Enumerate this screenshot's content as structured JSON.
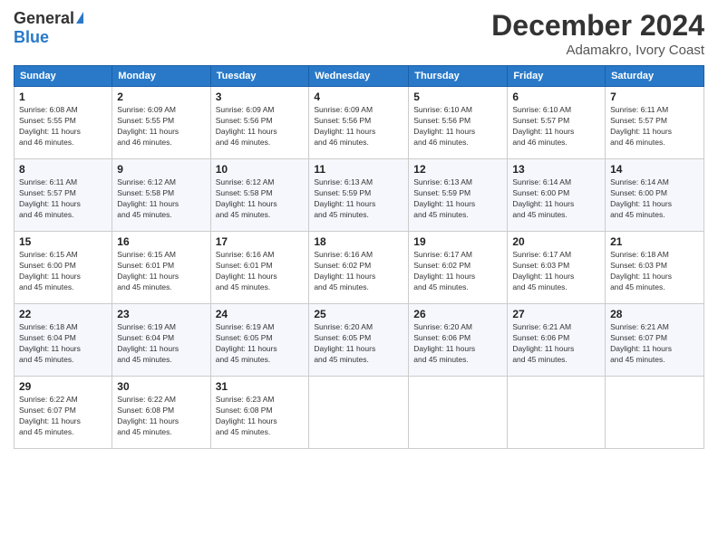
{
  "logo": {
    "general": "General",
    "blue": "Blue"
  },
  "header": {
    "month": "December 2024",
    "location": "Adamakro, Ivory Coast"
  },
  "weekdays": [
    "Sunday",
    "Monday",
    "Tuesday",
    "Wednesday",
    "Thursday",
    "Friday",
    "Saturday"
  ],
  "weeks": [
    [
      {
        "day": "1",
        "sunrise": "6:08 AM",
        "sunset": "5:55 PM",
        "daylight": "11 hours and 46 minutes."
      },
      {
        "day": "2",
        "sunrise": "6:09 AM",
        "sunset": "5:55 PM",
        "daylight": "11 hours and 46 minutes."
      },
      {
        "day": "3",
        "sunrise": "6:09 AM",
        "sunset": "5:56 PM",
        "daylight": "11 hours and 46 minutes."
      },
      {
        "day": "4",
        "sunrise": "6:09 AM",
        "sunset": "5:56 PM",
        "daylight": "11 hours and 46 minutes."
      },
      {
        "day": "5",
        "sunrise": "6:10 AM",
        "sunset": "5:56 PM",
        "daylight": "11 hours and 46 minutes."
      },
      {
        "day": "6",
        "sunrise": "6:10 AM",
        "sunset": "5:57 PM",
        "daylight": "11 hours and 46 minutes."
      },
      {
        "day": "7",
        "sunrise": "6:11 AM",
        "sunset": "5:57 PM",
        "daylight": "11 hours and 46 minutes."
      }
    ],
    [
      {
        "day": "8",
        "sunrise": "6:11 AM",
        "sunset": "5:57 PM",
        "daylight": "11 hours and 46 minutes."
      },
      {
        "day": "9",
        "sunrise": "6:12 AM",
        "sunset": "5:58 PM",
        "daylight": "11 hours and 45 minutes."
      },
      {
        "day": "10",
        "sunrise": "6:12 AM",
        "sunset": "5:58 PM",
        "daylight": "11 hours and 45 minutes."
      },
      {
        "day": "11",
        "sunrise": "6:13 AM",
        "sunset": "5:59 PM",
        "daylight": "11 hours and 45 minutes."
      },
      {
        "day": "12",
        "sunrise": "6:13 AM",
        "sunset": "5:59 PM",
        "daylight": "11 hours and 45 minutes."
      },
      {
        "day": "13",
        "sunrise": "6:14 AM",
        "sunset": "6:00 PM",
        "daylight": "11 hours and 45 minutes."
      },
      {
        "day": "14",
        "sunrise": "6:14 AM",
        "sunset": "6:00 PM",
        "daylight": "11 hours and 45 minutes."
      }
    ],
    [
      {
        "day": "15",
        "sunrise": "6:15 AM",
        "sunset": "6:00 PM",
        "daylight": "11 hours and 45 minutes."
      },
      {
        "day": "16",
        "sunrise": "6:15 AM",
        "sunset": "6:01 PM",
        "daylight": "11 hours and 45 minutes."
      },
      {
        "day": "17",
        "sunrise": "6:16 AM",
        "sunset": "6:01 PM",
        "daylight": "11 hours and 45 minutes."
      },
      {
        "day": "18",
        "sunrise": "6:16 AM",
        "sunset": "6:02 PM",
        "daylight": "11 hours and 45 minutes."
      },
      {
        "day": "19",
        "sunrise": "6:17 AM",
        "sunset": "6:02 PM",
        "daylight": "11 hours and 45 minutes."
      },
      {
        "day": "20",
        "sunrise": "6:17 AM",
        "sunset": "6:03 PM",
        "daylight": "11 hours and 45 minutes."
      },
      {
        "day": "21",
        "sunrise": "6:18 AM",
        "sunset": "6:03 PM",
        "daylight": "11 hours and 45 minutes."
      }
    ],
    [
      {
        "day": "22",
        "sunrise": "6:18 AM",
        "sunset": "6:04 PM",
        "daylight": "11 hours and 45 minutes."
      },
      {
        "day": "23",
        "sunrise": "6:19 AM",
        "sunset": "6:04 PM",
        "daylight": "11 hours and 45 minutes."
      },
      {
        "day": "24",
        "sunrise": "6:19 AM",
        "sunset": "6:05 PM",
        "daylight": "11 hours and 45 minutes."
      },
      {
        "day": "25",
        "sunrise": "6:20 AM",
        "sunset": "6:05 PM",
        "daylight": "11 hours and 45 minutes."
      },
      {
        "day": "26",
        "sunrise": "6:20 AM",
        "sunset": "6:06 PM",
        "daylight": "11 hours and 45 minutes."
      },
      {
        "day": "27",
        "sunrise": "6:21 AM",
        "sunset": "6:06 PM",
        "daylight": "11 hours and 45 minutes."
      },
      {
        "day": "28",
        "sunrise": "6:21 AM",
        "sunset": "6:07 PM",
        "daylight": "11 hours and 45 minutes."
      }
    ],
    [
      {
        "day": "29",
        "sunrise": "6:22 AM",
        "sunset": "6:07 PM",
        "daylight": "11 hours and 45 minutes."
      },
      {
        "day": "30",
        "sunrise": "6:22 AM",
        "sunset": "6:08 PM",
        "daylight": "11 hours and 45 minutes."
      },
      {
        "day": "31",
        "sunrise": "6:23 AM",
        "sunset": "6:08 PM",
        "daylight": "11 hours and 45 minutes."
      },
      null,
      null,
      null,
      null
    ]
  ],
  "labels": {
    "sunrise": "Sunrise:",
    "sunset": "Sunset:",
    "daylight": "Daylight:"
  }
}
